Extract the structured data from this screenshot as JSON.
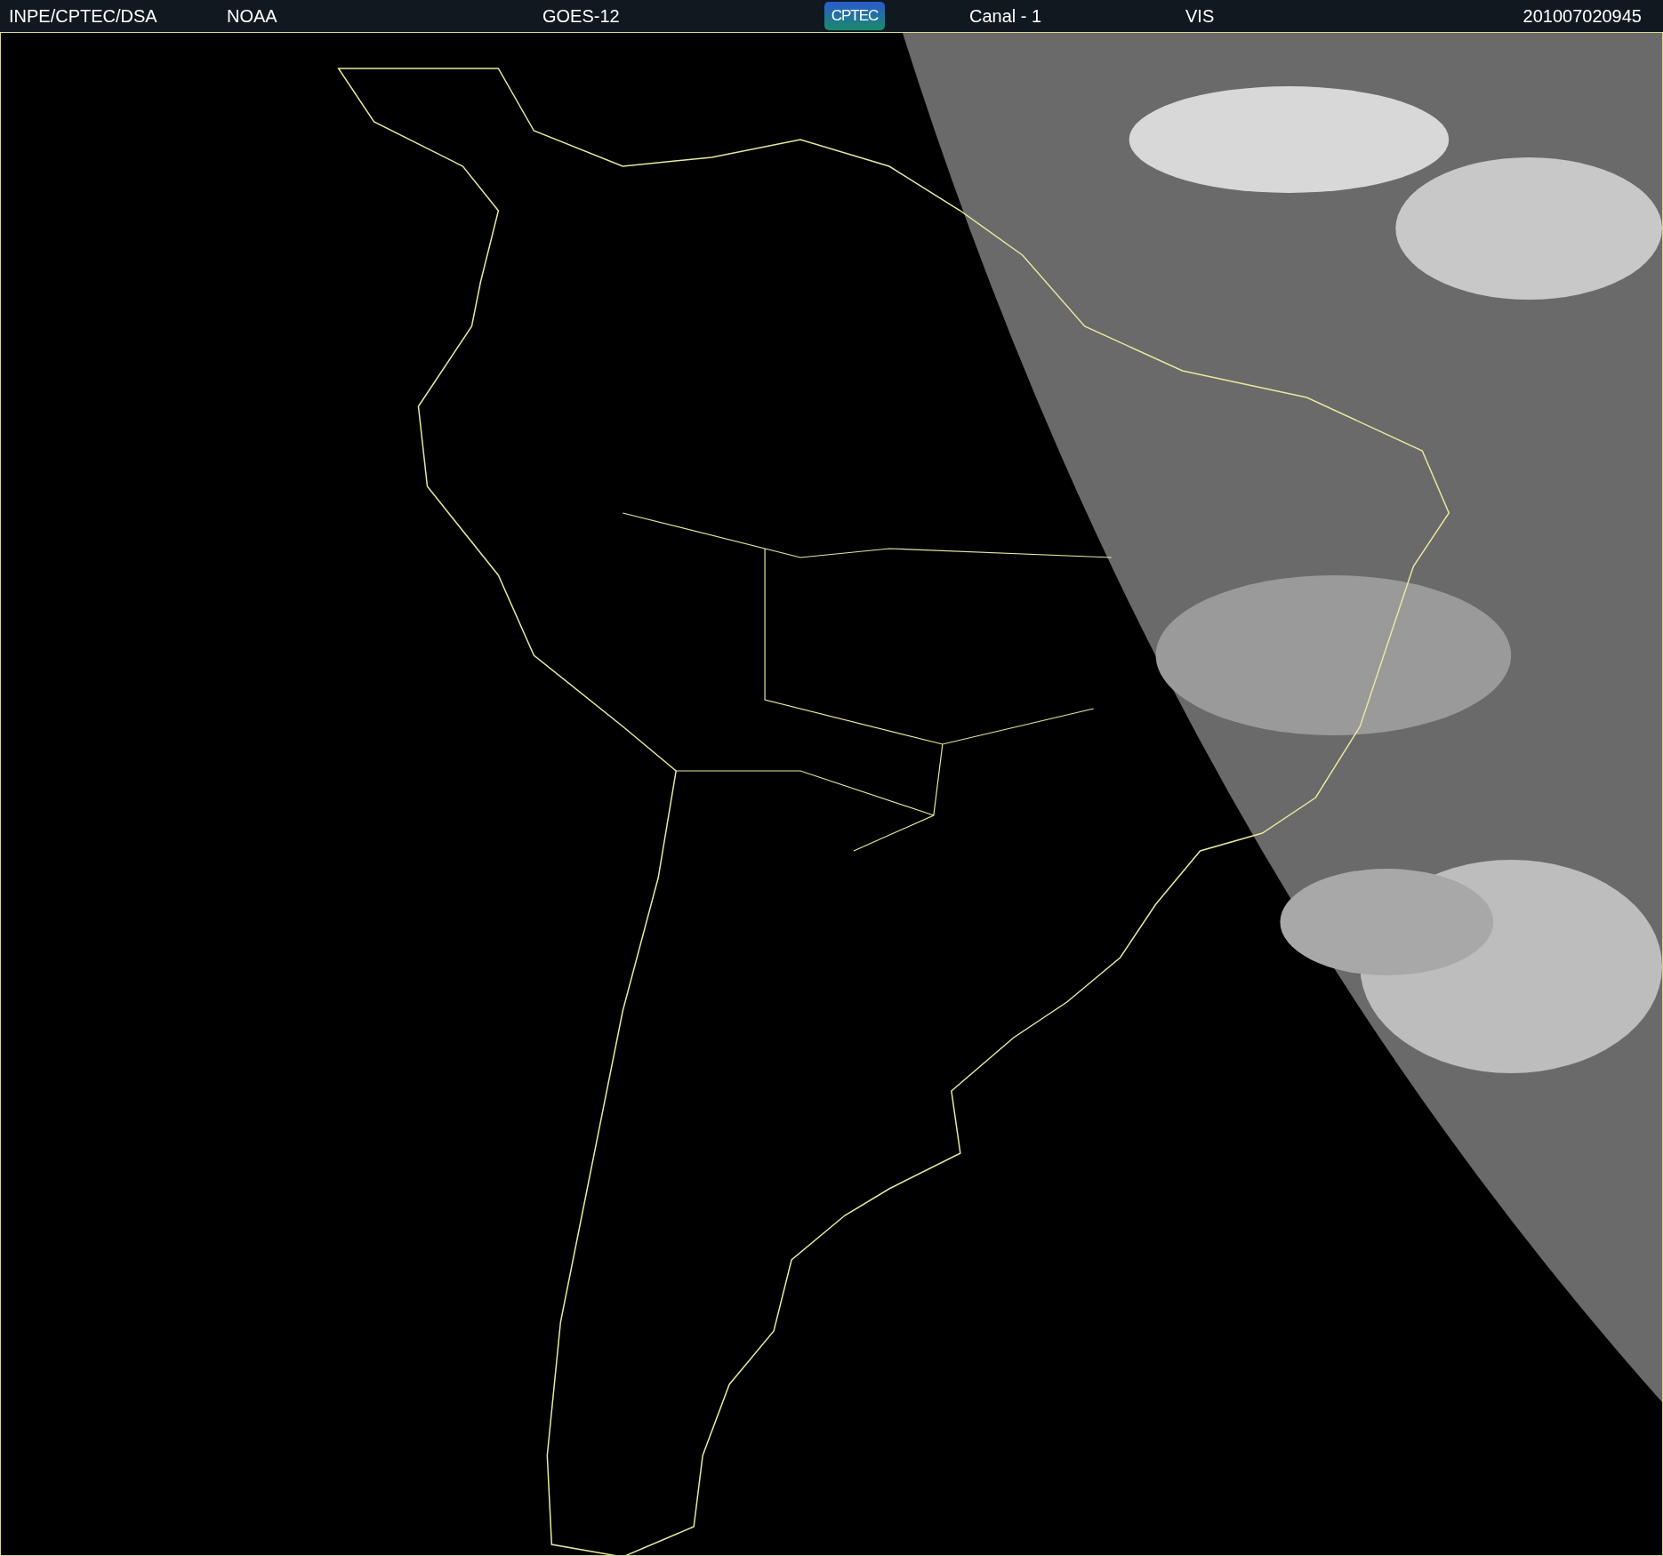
{
  "header": {
    "agency": "INPE/CPTEC/DSA",
    "source": "NOAA",
    "satellite": "GOES-12",
    "logo": "CPTEC",
    "channel": "Canal - 1",
    "band": "VIS",
    "timestamp": "201007020945"
  }
}
